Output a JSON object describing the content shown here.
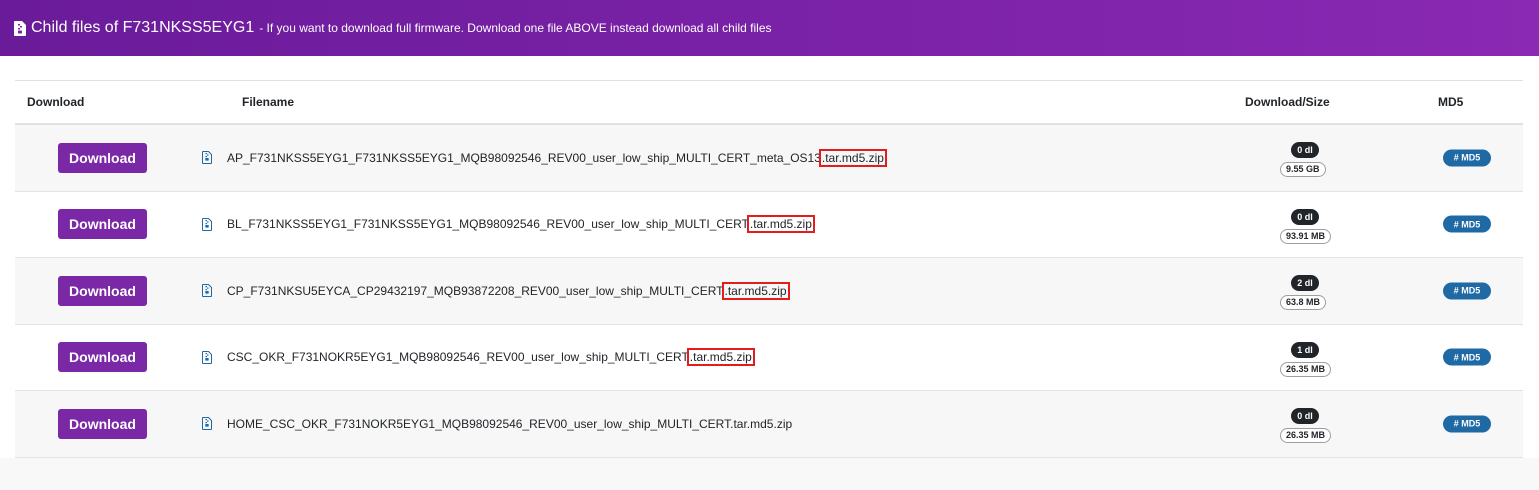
{
  "header": {
    "title": "Child files of F731NKSS5EYG1",
    "subtitle": "- If you want to download full firmware. Download one file ABOVE instead download all child files"
  },
  "columns": {
    "download": "Download",
    "filename": "Filename",
    "size": "Download/Size",
    "md5": "MD5"
  },
  "rows": [
    {
      "button": "Download",
      "name_prefix": "AP_F731NKSS5EYG1_F731NKSS5EYG1_MQB98092546_REV00_user_low_ship_MULTI_CERT_meta_OS13",
      "name_suffix": ".tar.md5.zip",
      "downloads": "0 dl",
      "size": "9.55 GB",
      "md5": "# MD5"
    },
    {
      "button": "Download",
      "name_prefix": "BL_F731NKSS5EYG1_F731NKSS5EYG1_MQB98092546_REV00_user_low_ship_MULTI_CERT",
      "name_suffix": ".tar.md5.zip",
      "downloads": "0 dl",
      "size": "93.91 MB",
      "md5": "# MD5"
    },
    {
      "button": "Download",
      "name_prefix": "CP_F731NKSU5EYCA_CP29432197_MQB93872208_REV00_user_low_ship_MULTI_CERT",
      "name_suffix": ".tar.md5.zip",
      "downloads": "2 dl",
      "size": "63.8 MB",
      "md5": "# MD5"
    },
    {
      "button": "Download",
      "name_prefix": "CSC_OKR_F731NOKR5EYG1_MQB98092546_REV00_user_low_ship_MULTI_CERT",
      "name_suffix": ".tar.md5.zip",
      "downloads": "1 dl",
      "size": "26.35 MB",
      "md5": "# MD5"
    },
    {
      "button": "Download",
      "name_prefix": "HOME_CSC_OKR_F731NOKR5EYG1_MQB98092546_REV00_user_low_ship_MULTI_CERT.tar.md5.zip",
      "name_suffix": "",
      "downloads": "0 dl",
      "size": "26.35 MB",
      "md5": "# MD5"
    }
  ],
  "colors": {
    "header_start": "#6a1b9a",
    "header_end": "#8a29b3",
    "download_button": "#7a28a6",
    "md5_button": "#1f6aa5",
    "highlight": "#e01e1e"
  },
  "icons": {
    "header": "file-zip-icon",
    "row": "file-zip-icon"
  }
}
